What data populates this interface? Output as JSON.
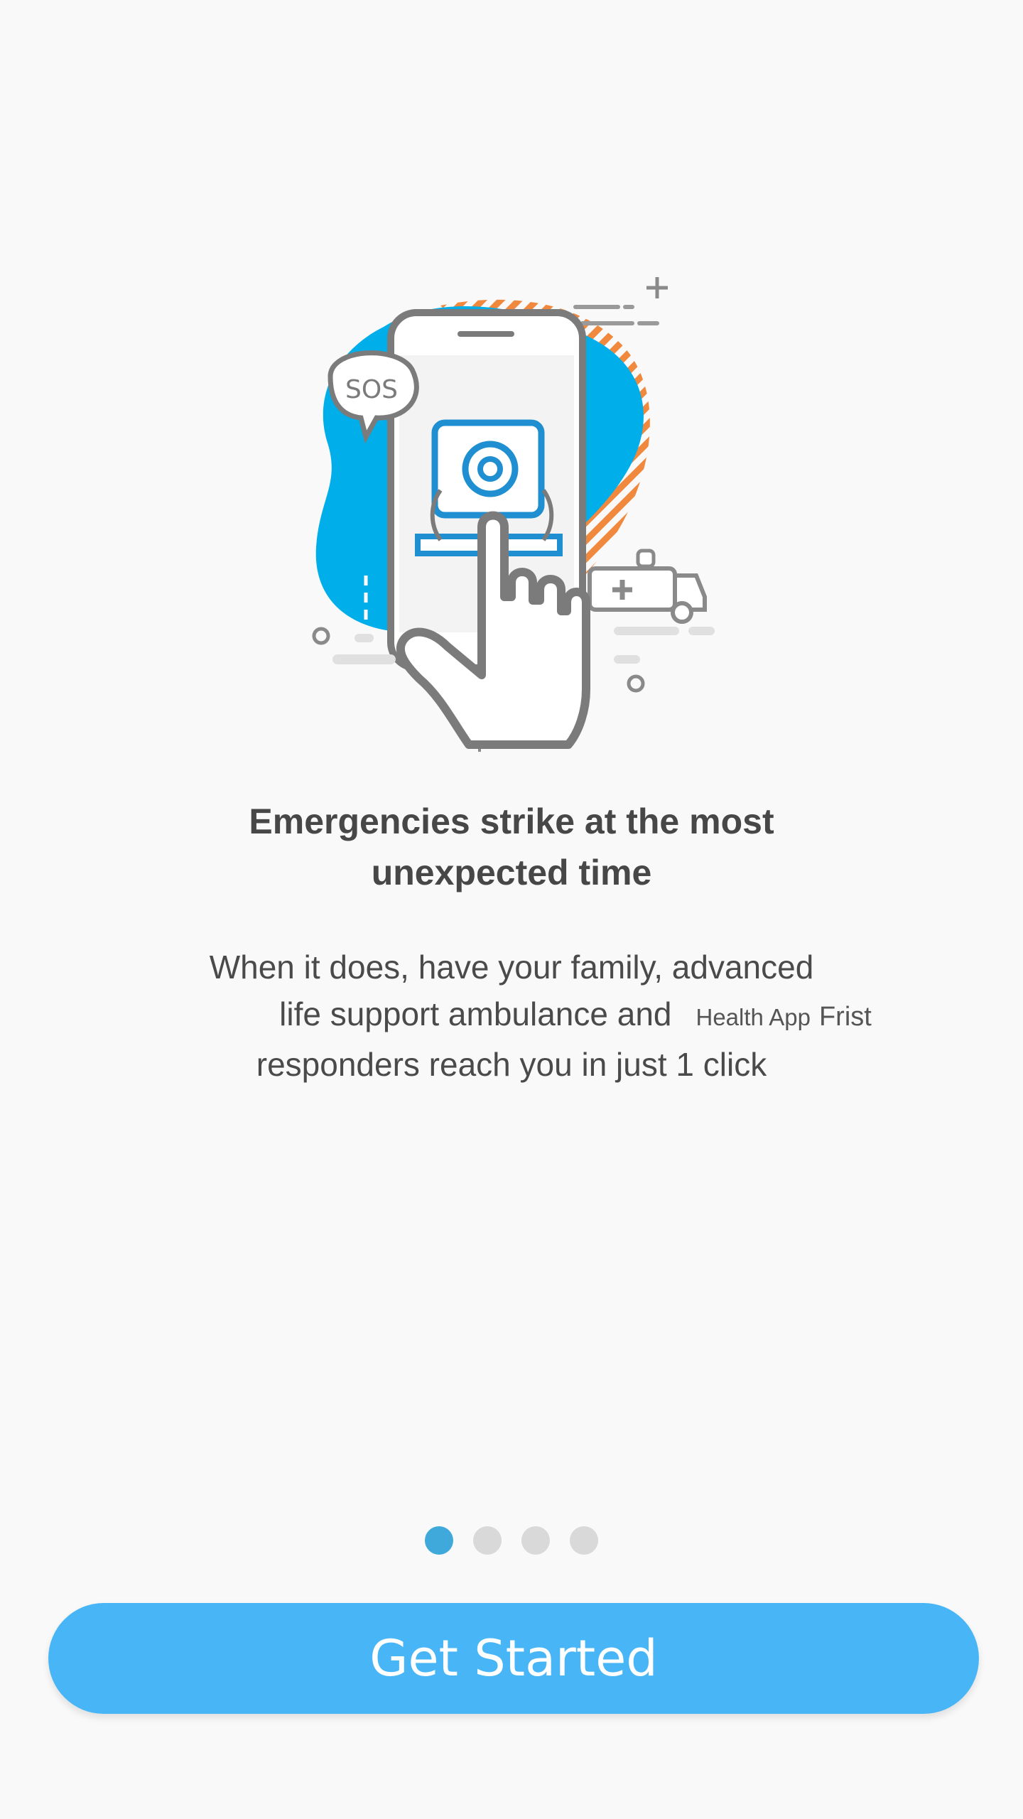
{
  "illustration": {
    "sos_text": "SOS"
  },
  "title": {
    "line1": "Emergencies strike at the most",
    "line2": "unexpected time"
  },
  "description": {
    "line1": "When it does, have your family, advanced",
    "line2": "life support ambulance and",
    "badge": "Health App",
    "badge_suffix": "Frist",
    "line3": "responders reach you in just 1 click"
  },
  "pagination": {
    "total": 4,
    "active_index": 0
  },
  "cta": {
    "label": "Get Started"
  },
  "colors": {
    "accent": "#48b6f6",
    "active_dot": "#40a9db",
    "blob": "#00aeea",
    "stripe": "#ef7c28"
  }
}
